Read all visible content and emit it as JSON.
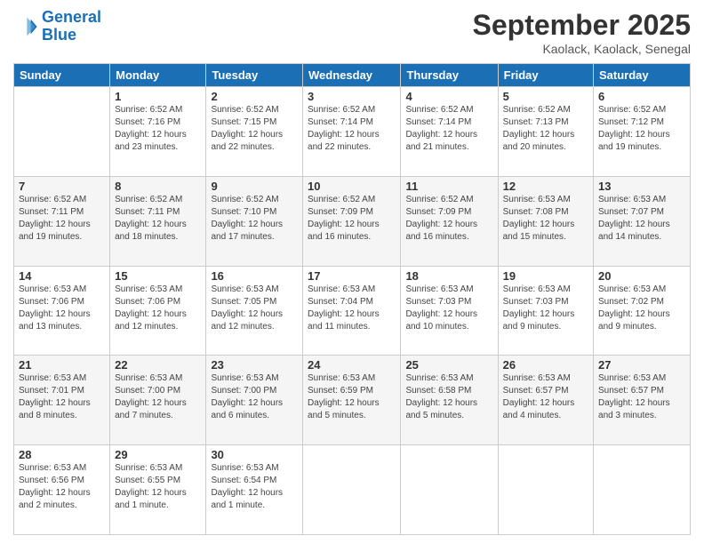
{
  "logo": {
    "line1": "General",
    "line2": "Blue"
  },
  "title": "September 2025",
  "subtitle": "Kaolack, Kaolack, Senegal",
  "days_of_week": [
    "Sunday",
    "Monday",
    "Tuesday",
    "Wednesday",
    "Thursday",
    "Friday",
    "Saturday"
  ],
  "weeks": [
    [
      {
        "day": "",
        "sunrise": "",
        "sunset": "",
        "daylight": ""
      },
      {
        "day": "1",
        "sunrise": "Sunrise: 6:52 AM",
        "sunset": "Sunset: 7:16 PM",
        "daylight": "Daylight: 12 hours and 23 minutes."
      },
      {
        "day": "2",
        "sunrise": "Sunrise: 6:52 AM",
        "sunset": "Sunset: 7:15 PM",
        "daylight": "Daylight: 12 hours and 22 minutes."
      },
      {
        "day": "3",
        "sunrise": "Sunrise: 6:52 AM",
        "sunset": "Sunset: 7:14 PM",
        "daylight": "Daylight: 12 hours and 22 minutes."
      },
      {
        "day": "4",
        "sunrise": "Sunrise: 6:52 AM",
        "sunset": "Sunset: 7:14 PM",
        "daylight": "Daylight: 12 hours and 21 minutes."
      },
      {
        "day": "5",
        "sunrise": "Sunrise: 6:52 AM",
        "sunset": "Sunset: 7:13 PM",
        "daylight": "Daylight: 12 hours and 20 minutes."
      },
      {
        "day": "6",
        "sunrise": "Sunrise: 6:52 AM",
        "sunset": "Sunset: 7:12 PM",
        "daylight": "Daylight: 12 hours and 19 minutes."
      }
    ],
    [
      {
        "day": "7",
        "sunrise": "Sunrise: 6:52 AM",
        "sunset": "Sunset: 7:11 PM",
        "daylight": "Daylight: 12 hours and 19 minutes."
      },
      {
        "day": "8",
        "sunrise": "Sunrise: 6:52 AM",
        "sunset": "Sunset: 7:11 PM",
        "daylight": "Daylight: 12 hours and 18 minutes."
      },
      {
        "day": "9",
        "sunrise": "Sunrise: 6:52 AM",
        "sunset": "Sunset: 7:10 PM",
        "daylight": "Daylight: 12 hours and 17 minutes."
      },
      {
        "day": "10",
        "sunrise": "Sunrise: 6:52 AM",
        "sunset": "Sunset: 7:09 PM",
        "daylight": "Daylight: 12 hours and 16 minutes."
      },
      {
        "day": "11",
        "sunrise": "Sunrise: 6:52 AM",
        "sunset": "Sunset: 7:09 PM",
        "daylight": "Daylight: 12 hours and 16 minutes."
      },
      {
        "day": "12",
        "sunrise": "Sunrise: 6:53 AM",
        "sunset": "Sunset: 7:08 PM",
        "daylight": "Daylight: 12 hours and 15 minutes."
      },
      {
        "day": "13",
        "sunrise": "Sunrise: 6:53 AM",
        "sunset": "Sunset: 7:07 PM",
        "daylight": "Daylight: 12 hours and 14 minutes."
      }
    ],
    [
      {
        "day": "14",
        "sunrise": "Sunrise: 6:53 AM",
        "sunset": "Sunset: 7:06 PM",
        "daylight": "Daylight: 12 hours and 13 minutes."
      },
      {
        "day": "15",
        "sunrise": "Sunrise: 6:53 AM",
        "sunset": "Sunset: 7:06 PM",
        "daylight": "Daylight: 12 hours and 12 minutes."
      },
      {
        "day": "16",
        "sunrise": "Sunrise: 6:53 AM",
        "sunset": "Sunset: 7:05 PM",
        "daylight": "Daylight: 12 hours and 12 minutes."
      },
      {
        "day": "17",
        "sunrise": "Sunrise: 6:53 AM",
        "sunset": "Sunset: 7:04 PM",
        "daylight": "Daylight: 12 hours and 11 minutes."
      },
      {
        "day": "18",
        "sunrise": "Sunrise: 6:53 AM",
        "sunset": "Sunset: 7:03 PM",
        "daylight": "Daylight: 12 hours and 10 minutes."
      },
      {
        "day": "19",
        "sunrise": "Sunrise: 6:53 AM",
        "sunset": "Sunset: 7:03 PM",
        "daylight": "Daylight: 12 hours and 9 minutes."
      },
      {
        "day": "20",
        "sunrise": "Sunrise: 6:53 AM",
        "sunset": "Sunset: 7:02 PM",
        "daylight": "Daylight: 12 hours and 9 minutes."
      }
    ],
    [
      {
        "day": "21",
        "sunrise": "Sunrise: 6:53 AM",
        "sunset": "Sunset: 7:01 PM",
        "daylight": "Daylight: 12 hours and 8 minutes."
      },
      {
        "day": "22",
        "sunrise": "Sunrise: 6:53 AM",
        "sunset": "Sunset: 7:00 PM",
        "daylight": "Daylight: 12 hours and 7 minutes."
      },
      {
        "day": "23",
        "sunrise": "Sunrise: 6:53 AM",
        "sunset": "Sunset: 7:00 PM",
        "daylight": "Daylight: 12 hours and 6 minutes."
      },
      {
        "day": "24",
        "sunrise": "Sunrise: 6:53 AM",
        "sunset": "Sunset: 6:59 PM",
        "daylight": "Daylight: 12 hours and 5 minutes."
      },
      {
        "day": "25",
        "sunrise": "Sunrise: 6:53 AM",
        "sunset": "Sunset: 6:58 PM",
        "daylight": "Daylight: 12 hours and 5 minutes."
      },
      {
        "day": "26",
        "sunrise": "Sunrise: 6:53 AM",
        "sunset": "Sunset: 6:57 PM",
        "daylight": "Daylight: 12 hours and 4 minutes."
      },
      {
        "day": "27",
        "sunrise": "Sunrise: 6:53 AM",
        "sunset": "Sunset: 6:57 PM",
        "daylight": "Daylight: 12 hours and 3 minutes."
      }
    ],
    [
      {
        "day": "28",
        "sunrise": "Sunrise: 6:53 AM",
        "sunset": "Sunset: 6:56 PM",
        "daylight": "Daylight: 12 hours and 2 minutes."
      },
      {
        "day": "29",
        "sunrise": "Sunrise: 6:53 AM",
        "sunset": "Sunset: 6:55 PM",
        "daylight": "Daylight: 12 hours and 1 minute."
      },
      {
        "day": "30",
        "sunrise": "Sunrise: 6:53 AM",
        "sunset": "Sunset: 6:54 PM",
        "daylight": "Daylight: 12 hours and 1 minute."
      },
      {
        "day": "",
        "sunrise": "",
        "sunset": "",
        "daylight": ""
      },
      {
        "day": "",
        "sunrise": "",
        "sunset": "",
        "daylight": ""
      },
      {
        "day": "",
        "sunrise": "",
        "sunset": "",
        "daylight": ""
      },
      {
        "day": "",
        "sunrise": "",
        "sunset": "",
        "daylight": ""
      }
    ]
  ]
}
